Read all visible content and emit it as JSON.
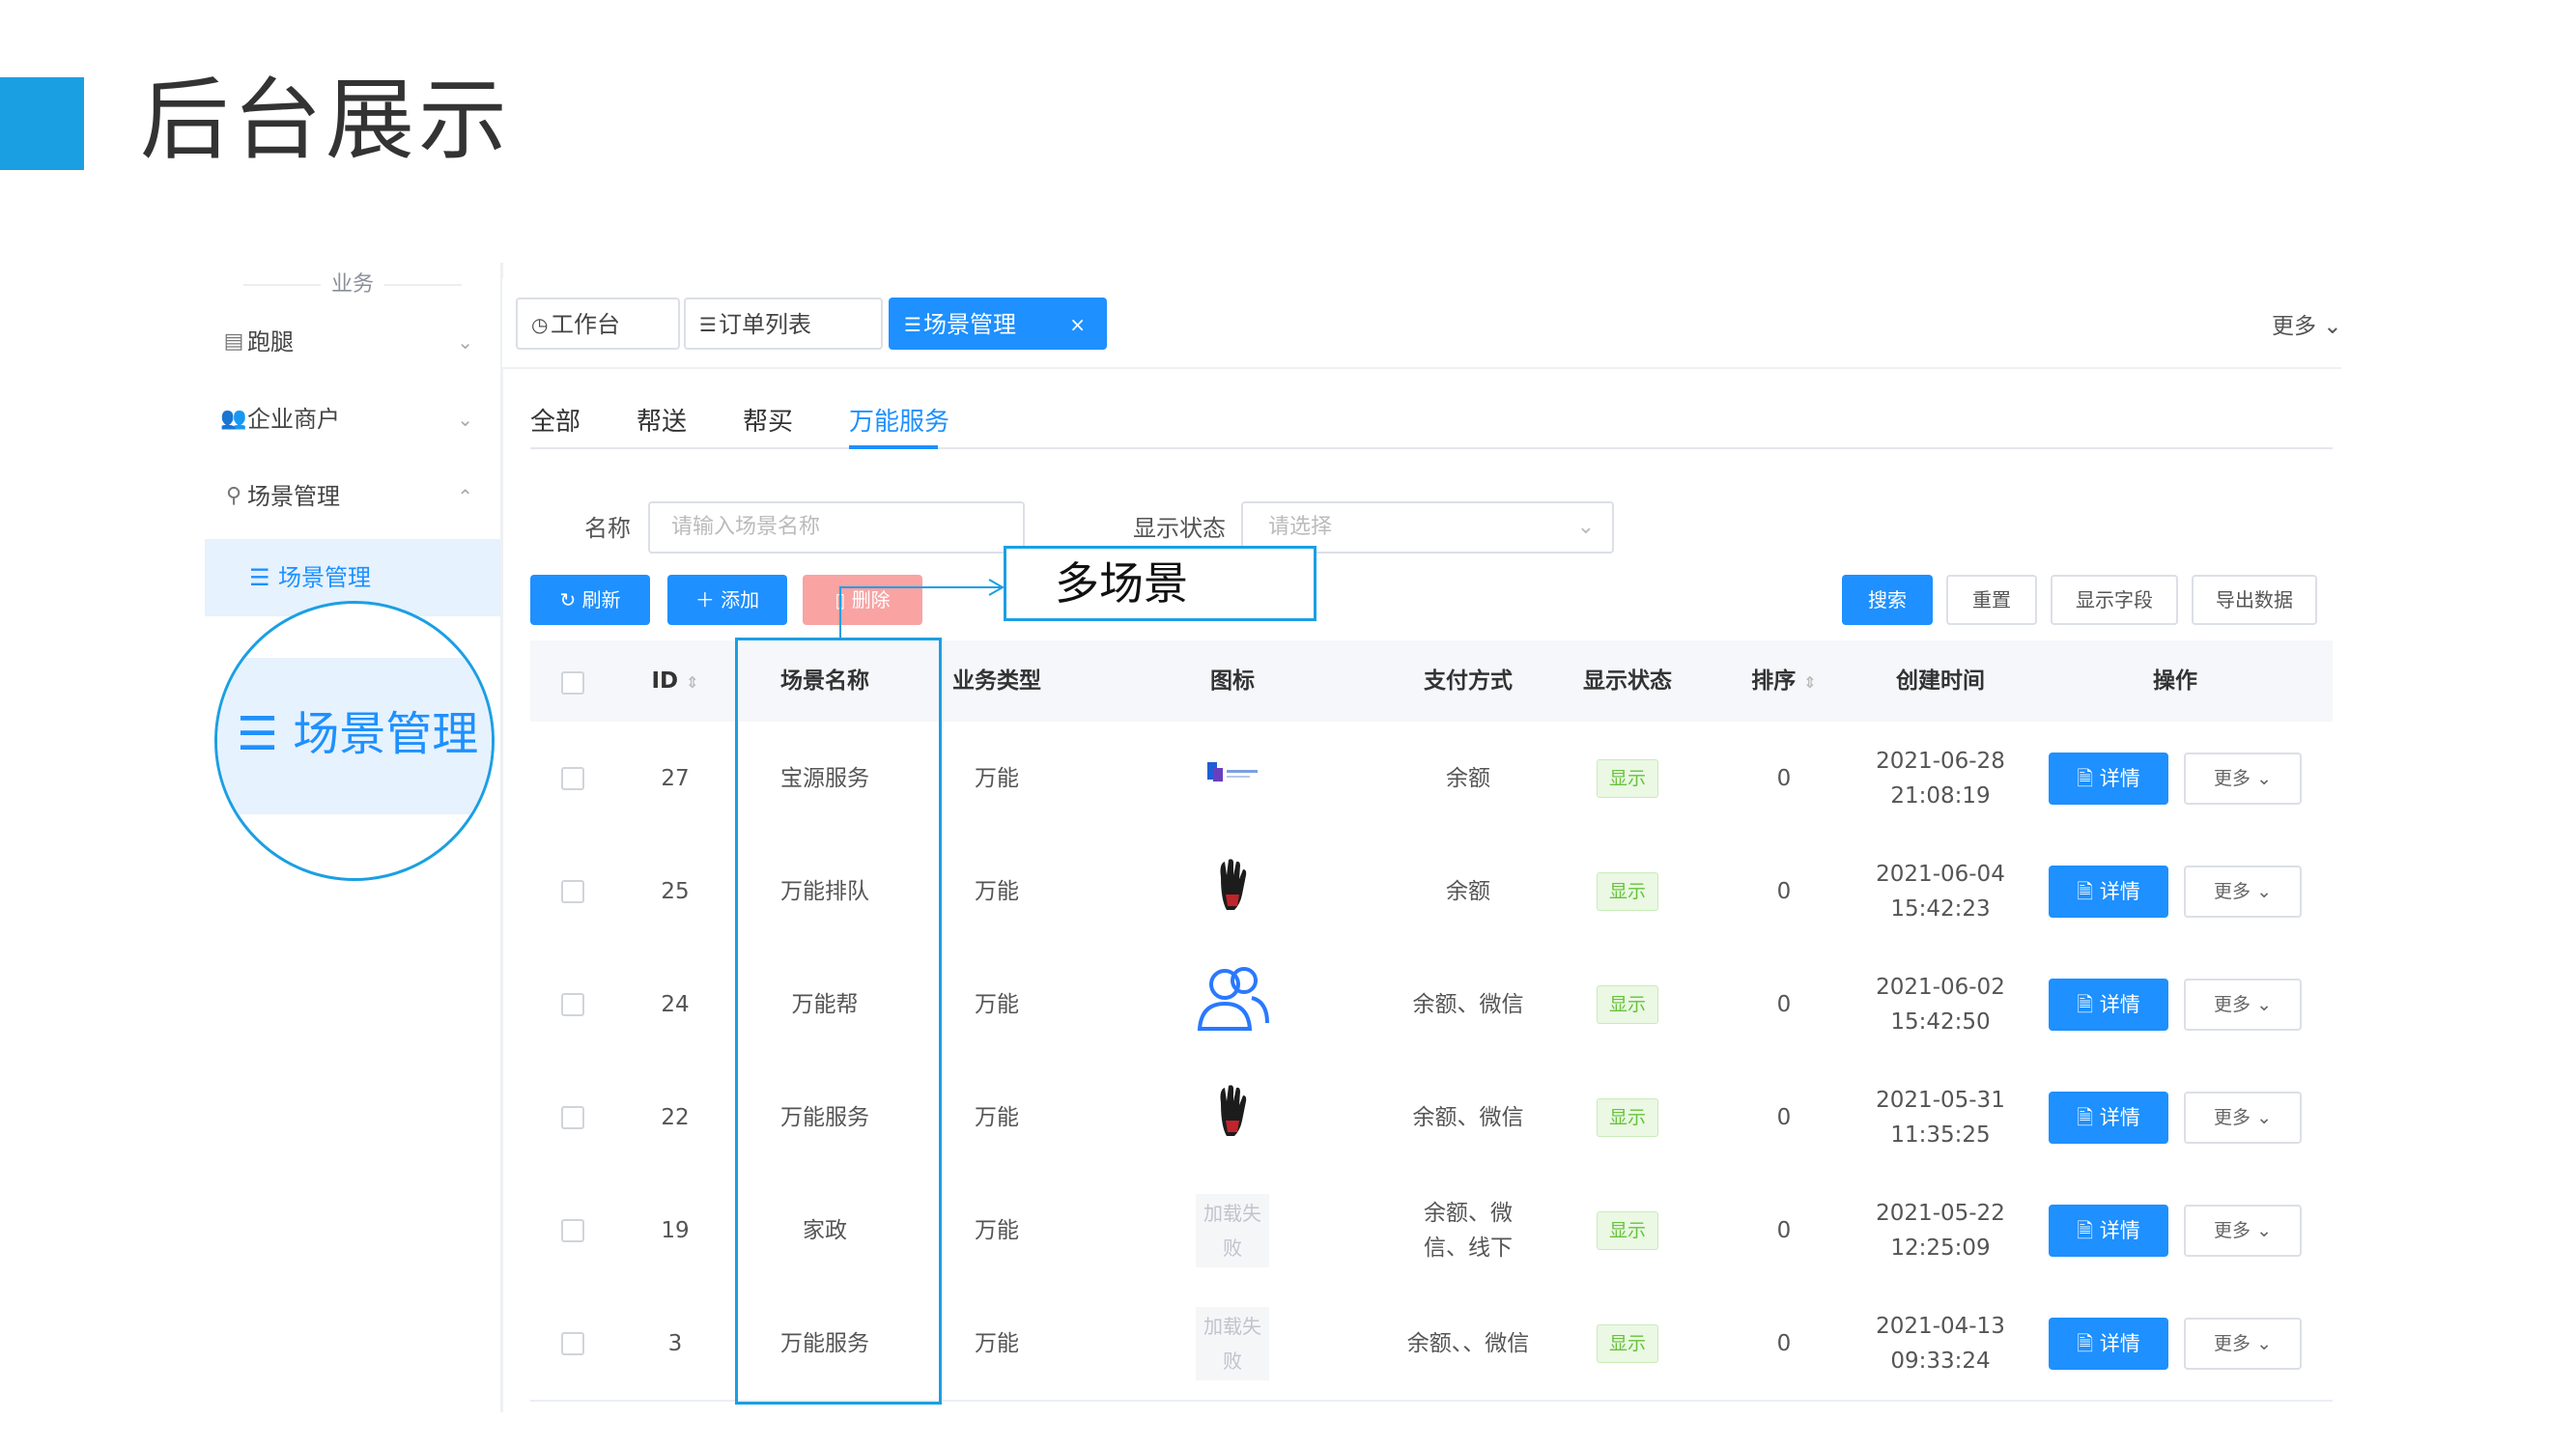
{
  "slide": {
    "title": "后台展示"
  },
  "sidebar": {
    "group_label": "业务",
    "items": [
      {
        "label": "跑腿",
        "icon": "errand-icon",
        "arrow": "⌄"
      },
      {
        "label": "企业商户",
        "icon": "merchant-icon",
        "arrow": "⌄"
      },
      {
        "label": "场景管理",
        "icon": "user-icon",
        "arrow": "⌃"
      }
    ],
    "sub_item": {
      "label": "场景管理",
      "icon": "menu-lines-icon"
    }
  },
  "zoom": {
    "label": "场景管理"
  },
  "tabs": [
    {
      "label": "工作台",
      "icon": "dashboard-icon"
    },
    {
      "label": "订单列表",
      "icon": "list-icon"
    },
    {
      "label": "场景管理",
      "icon": "list-icon",
      "close": "×"
    }
  ],
  "tabbar_more": "更多 ⌄",
  "subtabs": [
    "全部",
    "帮送",
    "帮买",
    "万能服务"
  ],
  "filters": {
    "name_label": "名称",
    "name_placeholder": "请输入场景名称",
    "status_label": "显示状态",
    "status_placeholder": "请选择"
  },
  "toolbar": {
    "refresh": "刷新",
    "add": "添加",
    "delete": "删除",
    "search": "搜索",
    "reset": "重置",
    "fields": "显示字段",
    "export": "导出数据"
  },
  "annotation": {
    "callout": "多场景"
  },
  "table": {
    "headers": [
      "ID",
      "场景名称",
      "业务类型",
      "图标",
      "支付方式",
      "显示状态",
      "排序",
      "创建时间",
      "操作"
    ],
    "detail_label": "详情",
    "more_label": "更多",
    "load_fail": "加载失败",
    "rows": [
      {
        "id": "27",
        "name": "宝源服务",
        "type": "万能",
        "icon": "logo",
        "pay": "余额",
        "status": "显示",
        "sort": "0",
        "date": "2021-06-28",
        "time": "21:08:19"
      },
      {
        "id": "25",
        "name": "万能排队",
        "type": "万能",
        "icon": "glove",
        "pay": "余额",
        "status": "显示",
        "sort": "0",
        "date": "2021-06-04",
        "time": "15:42:23"
      },
      {
        "id": "24",
        "name": "万能帮",
        "type": "万能",
        "icon": "users",
        "pay": "余额、微信",
        "status": "显示",
        "sort": "0",
        "date": "2021-06-02",
        "time": "15:42:50"
      },
      {
        "id": "22",
        "name": "万能服务",
        "type": "万能",
        "icon": "glove",
        "pay": "余额、微信",
        "status": "显示",
        "sort": "0",
        "date": "2021-05-31",
        "time": "11:35:25"
      },
      {
        "id": "19",
        "name": "家政",
        "type": "万能",
        "icon": "fail",
        "pay": "余额、微信、线下",
        "status": "显示",
        "sort": "0",
        "date": "2021-05-22",
        "time": "12:25:09"
      },
      {
        "id": "3",
        "name": "万能服务",
        "type": "万能",
        "icon": "fail",
        "pay": "余额、、微信",
        "status": "显示",
        "sort": "0",
        "date": "2021-04-13",
        "time": "09:33:24"
      }
    ]
  },
  "colors": {
    "accent": "#1b9fe3",
    "primary": "#1e90ff",
    "success": "#67c23a"
  }
}
